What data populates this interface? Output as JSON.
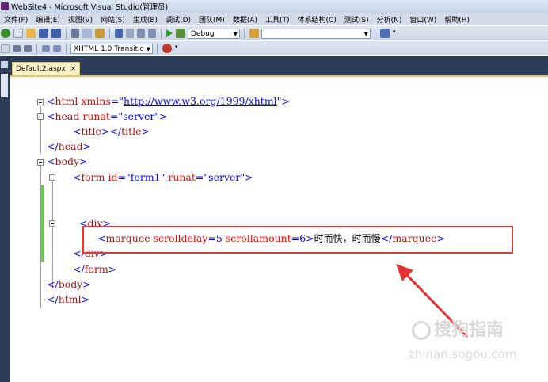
{
  "window": {
    "title": "WebSite4 - Microsoft Visual Studio(管理员)"
  },
  "menu": [
    "文件(F)",
    "编辑(E)",
    "视图(V)",
    "网站(S)",
    "生成(B)",
    "调试(D)",
    "团队(M)",
    "数据(A)",
    "工具(T)",
    "体系结构(C)",
    "测试(S)",
    "分析(N)",
    "窗口(W)",
    "帮助(H)"
  ],
  "toolbar": {
    "config_value": "Debug",
    "schema_value": "XHTML 1.0 Transitic"
  },
  "tab": {
    "label": "Default2.aspx",
    "close": "×"
  },
  "code": {
    "l1_tag": "html",
    "l1_attr": "xmlns",
    "l1_val": "http://www.w3.org/1999/xhtml",
    "l2_tag": "head",
    "l2_attr": "runat",
    "l2_val": "server",
    "l3_tag": "title",
    "l3_close": "title",
    "l4_close": "head",
    "l5_tag": "body",
    "l6_tag": "form",
    "l6_attr1": "id",
    "l6_val1": "form1",
    "l6_attr2": "runat",
    "l6_val2": "server",
    "l7_tag": "div",
    "l8_tag": "marquee",
    "l8_attr1": "scrolldelay",
    "l8_val1": "5",
    "l8_attr2": "scrollamount",
    "l8_val2": "6",
    "l8_text": "时而快，时而慢",
    "l8_close": "marquee",
    "l9_close": "div",
    "l10_close": "form",
    "l11_close": "body",
    "l12_close": "html"
  },
  "watermark": {
    "brand": "搜狗指南",
    "url": "zhinan.sogou.com"
  },
  "colors": {
    "accent_tab": "#fff4c8",
    "dark_band": "#2b3c59",
    "highlight_box": "#e33333",
    "arrow": "#e33333",
    "change_bar": "#6bc84f"
  }
}
